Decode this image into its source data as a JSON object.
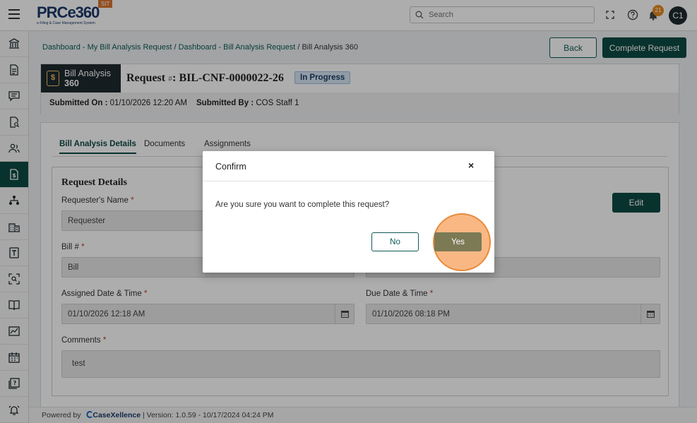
{
  "topbar": {
    "brand": "PRCe360",
    "brand_tagline": "e-Filing & Case Management System",
    "env_badge": "SIT",
    "search_placeholder": "Search",
    "notification_count": "21",
    "user_initials": "C1"
  },
  "sidebar": {
    "items": [
      {
        "icon": "bank-icon"
      },
      {
        "icon": "document-icon"
      },
      {
        "icon": "chat-icon"
      },
      {
        "icon": "doc-search-icon"
      },
      {
        "icon": "users-icon"
      },
      {
        "icon": "bill-dollar-icon",
        "active": true
      },
      {
        "icon": "org-tree-icon"
      },
      {
        "icon": "building-icon"
      },
      {
        "icon": "template-icon"
      },
      {
        "icon": "scan-icon"
      },
      {
        "icon": "book-icon"
      },
      {
        "icon": "chart-icon"
      },
      {
        "icon": "calendar-icon"
      },
      {
        "icon": "help-doc-icon"
      },
      {
        "icon": "alarm-icon"
      }
    ]
  },
  "breadcrumb": {
    "link1": "Dashboard - My Bill Analysis Request",
    "sep1": " / ",
    "link2": "Dashboard - Bill Analysis Request",
    "sep2": " / ",
    "current": "Bill Analysis 360"
  },
  "actions": {
    "back_label": "Back",
    "complete_label": "Complete Request"
  },
  "header": {
    "block_line1": "Bill Analysis",
    "block_line2": "360",
    "request_label": "Request ",
    "request_hash": "#",
    "request_id": ": BIL-CNF-0000022-26",
    "status": "In Progress",
    "submitted_on_label": "Submitted On : ",
    "submitted_on_value": "01/10/2026 12:20 AM",
    "submitted_by_label": "Submitted By : ",
    "submitted_by_value": "COS Staff 1"
  },
  "tabs": [
    "Bill Analysis Details",
    "Documents",
    "Assignments"
  ],
  "form": {
    "section_title": "Request Details",
    "edit_label": "Edit",
    "requester_label": "Requester's Name",
    "requester_value": "Requester",
    "bill_label": "Bill #",
    "bill_value": "Bill",
    "assigned_label": "Assigned Date & Time",
    "assigned_value": "01/10/2026 12:18 AM",
    "due_label": "Due Date & Time",
    "due_value": "01/10/2026  08:18 PM",
    "comments_label": "Comments",
    "comments_value": "test",
    "required_mark": "*"
  },
  "footer": {
    "powered_by": "Powered by",
    "brand": "CaseXellence",
    "version": "|  Version: 1.0.59 - 10/17/2024 04:24 PM"
  },
  "dialog": {
    "title": "Confirm",
    "close": "×",
    "message": "Are you sure you want to complete this request?",
    "no_label": "No",
    "yes_label": "Yes"
  }
}
